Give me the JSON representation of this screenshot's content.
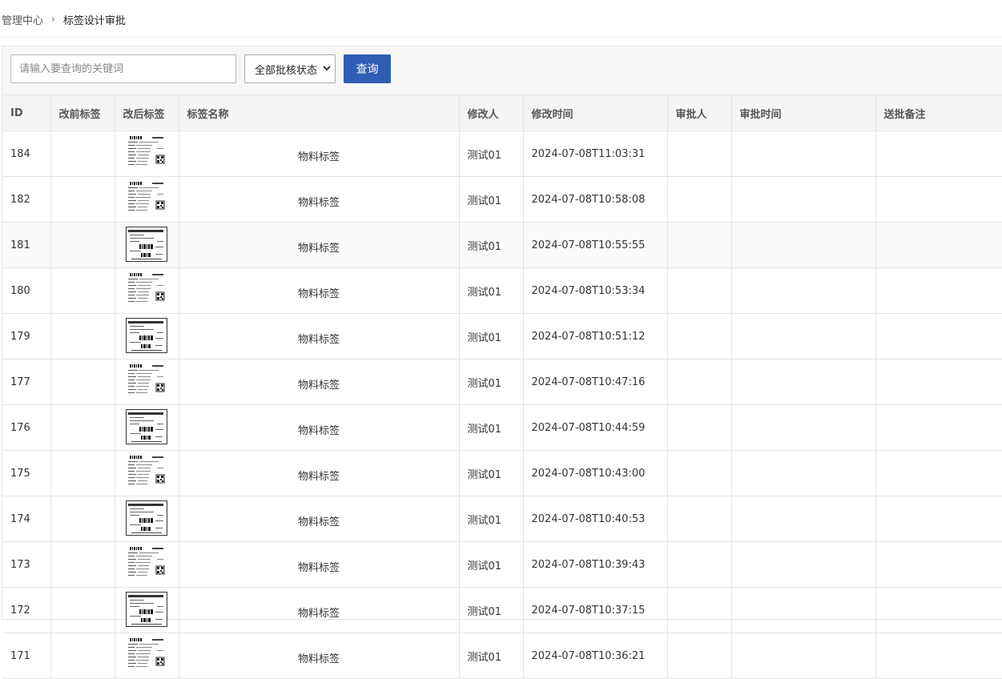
{
  "breadcrumb": {
    "root": "管理中心",
    "separator": "›",
    "current": "标签设计审批"
  },
  "search": {
    "placeholder": "请输入要查询的关键词",
    "value": ""
  },
  "status_filter": {
    "selected": "全部批核状态"
  },
  "query_label": "查询",
  "columns": [
    "ID",
    "改前标签",
    "改后标签",
    "标签名称",
    "修改人",
    "修改时间",
    "审批人",
    "审批时间",
    "送批备注"
  ],
  "rows": [
    {
      "id": "184",
      "thumb": "tall",
      "name": "物料标签",
      "modifier": "测试01",
      "time": "2024-07-08T11:03:31"
    },
    {
      "id": "182",
      "thumb": "tall",
      "name": "物料标签",
      "modifier": "测试01",
      "time": "2024-07-08T10:58:08"
    },
    {
      "id": "181",
      "thumb": "boxed",
      "name": "物料标签",
      "modifier": "测试01",
      "time": "2024-07-08T10:55:55"
    },
    {
      "id": "180",
      "thumb": "tall",
      "name": "物料标签",
      "modifier": "测试01",
      "time": "2024-07-08T10:53:34"
    },
    {
      "id": "179",
      "thumb": "boxed",
      "name": "物料标签",
      "modifier": "测试01",
      "time": "2024-07-08T10:51:12"
    },
    {
      "id": "177",
      "thumb": "tall",
      "name": "物料标签",
      "modifier": "测试01",
      "time": "2024-07-08T10:47:16"
    },
    {
      "id": "176",
      "thumb": "boxed",
      "name": "物料标签",
      "modifier": "测试01",
      "time": "2024-07-08T10:44:59"
    },
    {
      "id": "175",
      "thumb": "tall",
      "name": "物料标签",
      "modifier": "测试01",
      "time": "2024-07-08T10:43:00"
    },
    {
      "id": "174",
      "thumb": "boxed",
      "name": "物料标签",
      "modifier": "测试01",
      "time": "2024-07-08T10:40:53"
    },
    {
      "id": "173",
      "thumb": "tall",
      "name": "物料标签",
      "modifier": "测试01",
      "time": "2024-07-08T10:39:43"
    },
    {
      "id": "172",
      "thumb": "boxed",
      "name": "物料标签",
      "modifier": "测试01",
      "time": "2024-07-08T10:37:15"
    },
    {
      "id": "171",
      "thumb": "tall",
      "name": "物料标签",
      "modifier": "测试01",
      "time": "2024-07-08T10:36:21"
    }
  ],
  "colors": {
    "primary": "#2f5db3",
    "toolbar_bg": "#f7f7f7",
    "header_bg": "#f5f5f5",
    "border": "#e4e4e4"
  }
}
